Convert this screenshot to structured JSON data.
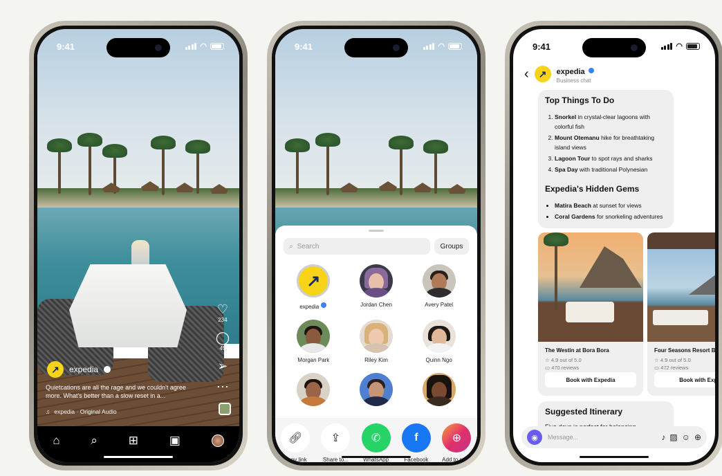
{
  "status": {
    "time": "9:41"
  },
  "reel": {
    "username": "expedia",
    "caption": "Quietcations are all the rage and we couldn't agree more. What's better than a slow reset in a...",
    "audio": "expedia · Original Audio",
    "likes": "234",
    "comments": "45",
    "nav": [
      "home-icon",
      "search-icon",
      "create-icon",
      "reels-icon",
      "profile-icon"
    ]
  },
  "share": {
    "search_placeholder": "Search",
    "groups_label": "Groups",
    "contacts": [
      {
        "name": "expedia",
        "verified": true
      },
      {
        "name": "Jordan Chen"
      },
      {
        "name": "Avery Patel"
      },
      {
        "name": "Morgan Park"
      },
      {
        "name": "Riley Kim"
      },
      {
        "name": "Quinn Ngo"
      },
      {
        "name": ""
      },
      {
        "name": ""
      },
      {
        "name": ""
      }
    ],
    "actions": [
      {
        "label": "Copy link",
        "icon": "link-icon",
        "color": "#ffffff"
      },
      {
        "label": "Share to...",
        "icon": "share-icon",
        "color": "#ffffff"
      },
      {
        "label": "WhatsApp",
        "icon": "whatsapp-icon",
        "color": "#25d366"
      },
      {
        "label": "Facebook",
        "icon": "facebook-icon",
        "color": "#1877f2"
      },
      {
        "label": "Add to story",
        "icon": "story-icon",
        "color": "#e1306c"
      }
    ]
  },
  "chat": {
    "name": "expedia",
    "subtitle": "Business chat",
    "things_title": "Top Things To Do",
    "things": [
      {
        "bold": "Snorkel",
        "rest": " in crystal-clear lagoons with colorful fish"
      },
      {
        "bold": "Mount Otemanu",
        "rest": " hike for breathtaking island views"
      },
      {
        "bold": "Lagoon Tour",
        "rest": " to spot rays and sharks"
      },
      {
        "bold": "Spa Day",
        "rest": " with traditional Polynesian"
      }
    ],
    "gems_title": "Expedia's Hidden Gems",
    "gems": [
      {
        "bold": "Matira Beach",
        "rest": " at sunset for views"
      },
      {
        "bold": "Coral Gardens",
        "rest": " for snorkeling adventures"
      }
    ],
    "cards": [
      {
        "title": "The Westin at Bora Bora",
        "rating": "4.9 out of 5.0",
        "reviews": "470 reviews",
        "button": "Book with Expedia"
      },
      {
        "title": "Four Seasons Resort B",
        "rating": "4.9 out of 5.0",
        "reviews": "472 reviews",
        "button": "Book with Expe"
      }
    ],
    "itinerary_title": "Suggested Itinerary",
    "itinerary_text": "Five days is perfect for balancing",
    "composer_placeholder": "Message..."
  }
}
